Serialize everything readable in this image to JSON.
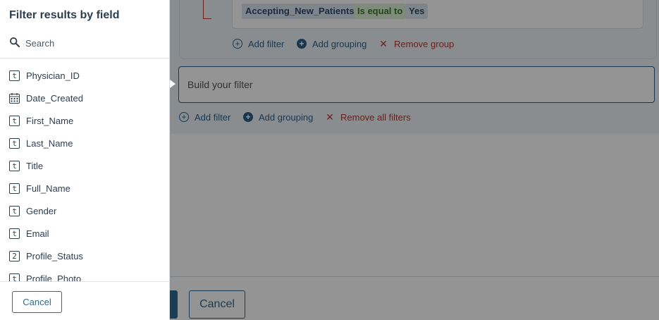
{
  "panel": {
    "title": "Filter results by field",
    "search_placeholder": "Search",
    "fields": [
      {
        "type": "t",
        "label": "Physician_ID"
      },
      {
        "type": "date",
        "label": "Date_Created"
      },
      {
        "type": "t",
        "label": "First_Name"
      },
      {
        "type": "t",
        "label": "Last_Name"
      },
      {
        "type": "t",
        "label": "Title"
      },
      {
        "type": "t",
        "label": "Full_Name"
      },
      {
        "type": "t",
        "label": "Gender"
      },
      {
        "type": "t",
        "label": "Email"
      },
      {
        "type": "2",
        "label": "Profile_Status"
      },
      {
        "type": "t",
        "label": "Profile_Photo"
      }
    ],
    "cancel_label": "Cancel"
  },
  "group": {
    "condition": {
      "field": "Accepting_New_Patients",
      "operator": "Is equal to",
      "value": "Yes"
    },
    "add_filter": "Add filter",
    "add_grouping": "Add grouping",
    "remove_group": "Remove group"
  },
  "filter_input": {
    "placeholder": "Build your filter"
  },
  "root_actions": {
    "add_filter": "Add filter",
    "add_grouping": "Add grouping",
    "remove_all": "Remove all filters"
  },
  "footer": {
    "cancel_label": "Cancel"
  },
  "colors": {
    "accent": "#2b6a92",
    "danger": "#b03a2e",
    "operator_bg": "#dcefd6"
  }
}
